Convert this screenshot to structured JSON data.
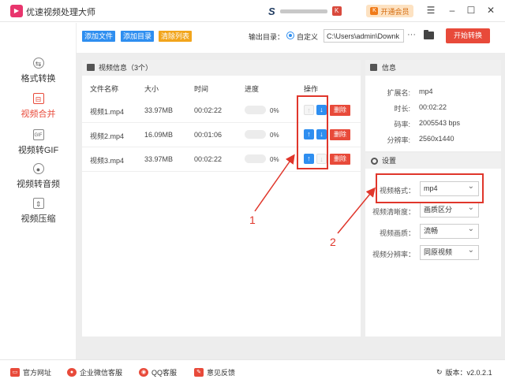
{
  "app": {
    "title": "优速视频处理大师",
    "vip_label": "开通会员"
  },
  "sidebar": {
    "items": [
      {
        "label": "格式转换",
        "icon": "format-convert-icon",
        "active": false
      },
      {
        "label": "视频合并",
        "icon": "video-merge-icon",
        "active": true
      },
      {
        "label": "视频转GIF",
        "icon": "gif-icon",
        "active": false
      },
      {
        "label": "视频转音频",
        "icon": "audio-icon",
        "active": false
      },
      {
        "label": "视频压缩",
        "icon": "compress-icon",
        "active": false
      }
    ]
  },
  "toolbar": {
    "add_file": "添加文件",
    "add_folder": "添加目录",
    "clear_list": "清除列表",
    "output_label": "输出目录：",
    "custom_label": "自定义",
    "output_path": "C:\\Users\\admin\\Downk",
    "dots": "···",
    "start": "开始转换"
  },
  "video_panel": {
    "title": "视频信息（3个）",
    "columns": {
      "name": "文件名称",
      "size": "大小",
      "time": "时间",
      "progress": "进度",
      "action": "操作"
    },
    "delete_label": "删除",
    "rows": [
      {
        "name": "视频1.mp4",
        "size": "33.97MB",
        "time": "00:02:22",
        "progress": "0%",
        "up_enabled": false,
        "down_enabled": true
      },
      {
        "name": "视频2.mp4",
        "size": "16.09MB",
        "time": "00:01:06",
        "progress": "0%",
        "up_enabled": true,
        "down_enabled": true
      },
      {
        "name": "视频3.mp4",
        "size": "33.97MB",
        "time": "00:02:22",
        "progress": "0%",
        "up_enabled": true,
        "down_enabled": false
      }
    ]
  },
  "info_panel": {
    "title": "信息",
    "fields": [
      {
        "k": "扩展名:",
        "v": "mp4"
      },
      {
        "k": "时长:",
        "v": "00:02:22"
      },
      {
        "k": "码率:",
        "v": "2005543 bps"
      },
      {
        "k": "分辨率:",
        "v": "2560x1440"
      }
    ]
  },
  "settings_panel": {
    "title": "设置",
    "fields": [
      {
        "k": "视频格式：",
        "v": "mp4"
      },
      {
        "k": "视频清晰度：",
        "v": "画质区分"
      },
      {
        "k": "视频画质：",
        "v": "流畅"
      },
      {
        "k": "视频分辨率：",
        "v": "同原视频"
      }
    ]
  },
  "annotations": {
    "one": "1",
    "two": "2"
  },
  "bottom": {
    "website": "官方网址",
    "wechat": "企业微信客服",
    "qq": "QQ客服",
    "feedback": "意见反馈",
    "version": "版本：v2.0.2.1"
  },
  "colors": {
    "accent_red": "#e84a3a",
    "accent_blue": "#2e8ef0",
    "accent_orange": "#f2a51c"
  }
}
